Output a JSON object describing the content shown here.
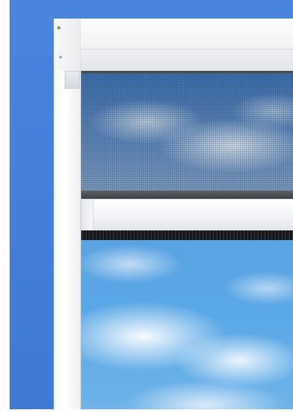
{
  "image": {
    "colors": {
      "backdrop": "#4a84df",
      "frame": "#f2f3f5",
      "mesh_border": "#4a4d52",
      "brush": "#1d1d1f",
      "sky": "#5aa8e6"
    }
  }
}
